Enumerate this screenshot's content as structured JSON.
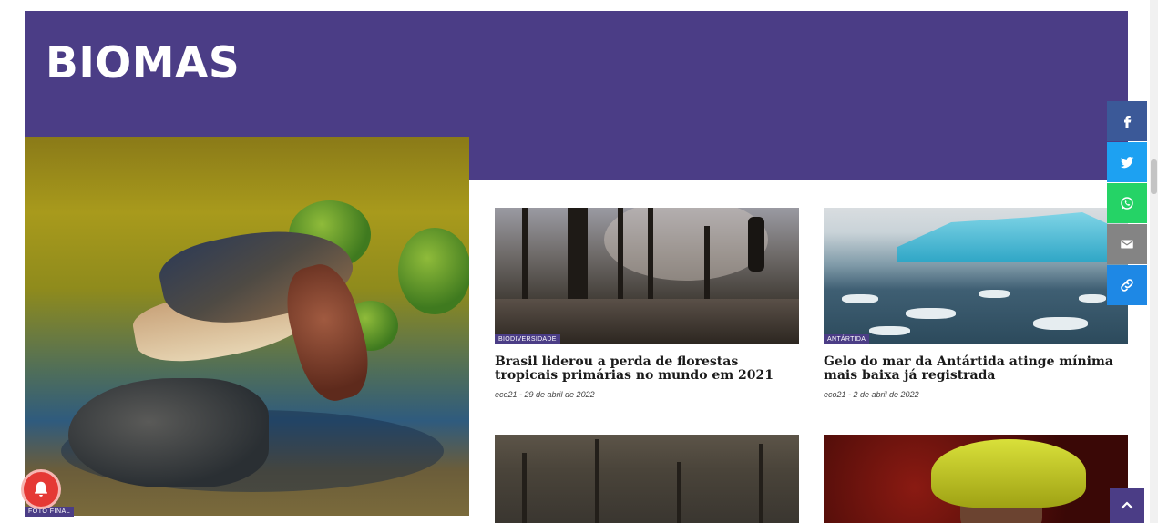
{
  "section": {
    "title": "BIOMAS"
  },
  "featured": {
    "badge": "FOTO FINAL"
  },
  "articles": [
    {
      "category": "BIODIVERSIDADE",
      "title": "Brasil liderou a perda de florestas tropicais primárias no mundo em 2021",
      "meta": "eco21 - 29 de abril de 2022"
    },
    {
      "category": "ANTÁRTIDA",
      "title": "Gelo do mar da Antártida atinge mínima mais baixa já registrada",
      "meta": "eco21 - 2 de abril de 2022"
    }
  ],
  "share": {
    "buttons": [
      {
        "icon": "facebook-icon",
        "color": "#3b5998"
      },
      {
        "icon": "twitter-icon",
        "color": "#1da1f2"
      },
      {
        "icon": "whatsapp-icon",
        "color": "#25d366"
      },
      {
        "icon": "email-icon",
        "color": "#848484"
      },
      {
        "icon": "link-icon",
        "color": "#1e88e5"
      }
    ]
  },
  "colors": {
    "accent": "#4b3d86",
    "notification": "#e53935"
  }
}
